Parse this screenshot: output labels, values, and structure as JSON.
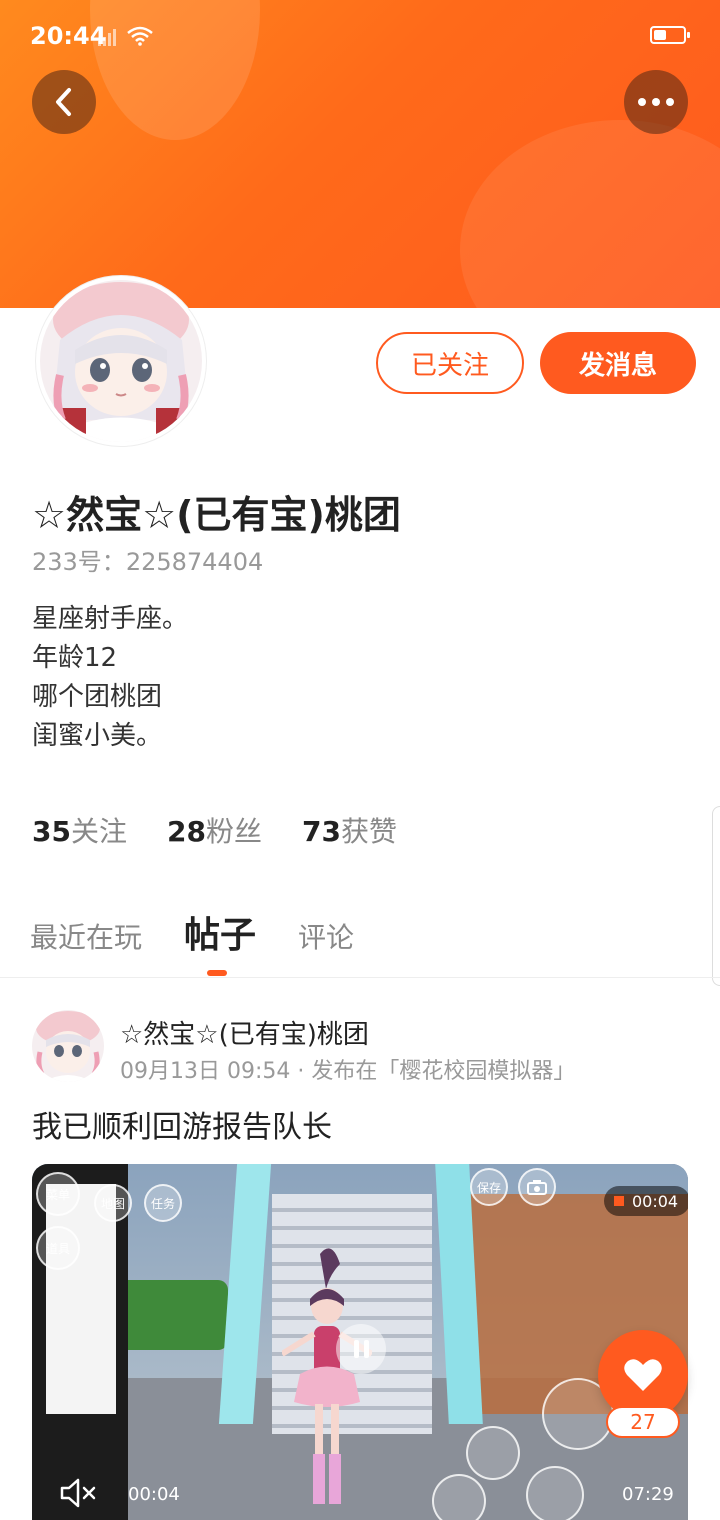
{
  "status_bar": {
    "time": "20:44"
  },
  "profile": {
    "follow_label": "已关注",
    "message_label": "发消息",
    "username": "☆然宝☆(已有宝)桃团",
    "uid_label": "233号：",
    "uid": "225874404",
    "bio": [
      "星座射手座。",
      "年龄12",
      "哪个团桃团",
      "闺蜜小美。"
    ],
    "stats": [
      {
        "num": "35",
        "label": "关注"
      },
      {
        "num": "28",
        "label": "粉丝"
      },
      {
        "num": "73",
        "label": "获赞"
      }
    ]
  },
  "tabs": [
    {
      "label": "最近在玩",
      "active": false
    },
    {
      "label": "帖子",
      "active": true
    },
    {
      "label": "评论",
      "active": false
    }
  ],
  "post": {
    "author": "☆然宝☆(已有宝)桃团",
    "meta": "09月13日 09:54 · 发布在「樱花校园模拟器」",
    "title": "我已顺利回游报告队长",
    "video": {
      "recording_time": "00:04",
      "current_time": "00:04",
      "total_time": "07:29",
      "hud": {
        "menu": "菜单",
        "props": "道具",
        "map": "地图",
        "task": "任务",
        "save": "保存"
      }
    },
    "likes": "27"
  },
  "colors": {
    "accent": "#ff5a1f",
    "header": "#ff7a1c"
  },
  "icons": [
    "back-arrow-icon",
    "more-dots-icon",
    "heart-icon",
    "mute-icon",
    "pause-icon",
    "wifi-icon",
    "signal-icon",
    "battery-icon"
  ]
}
